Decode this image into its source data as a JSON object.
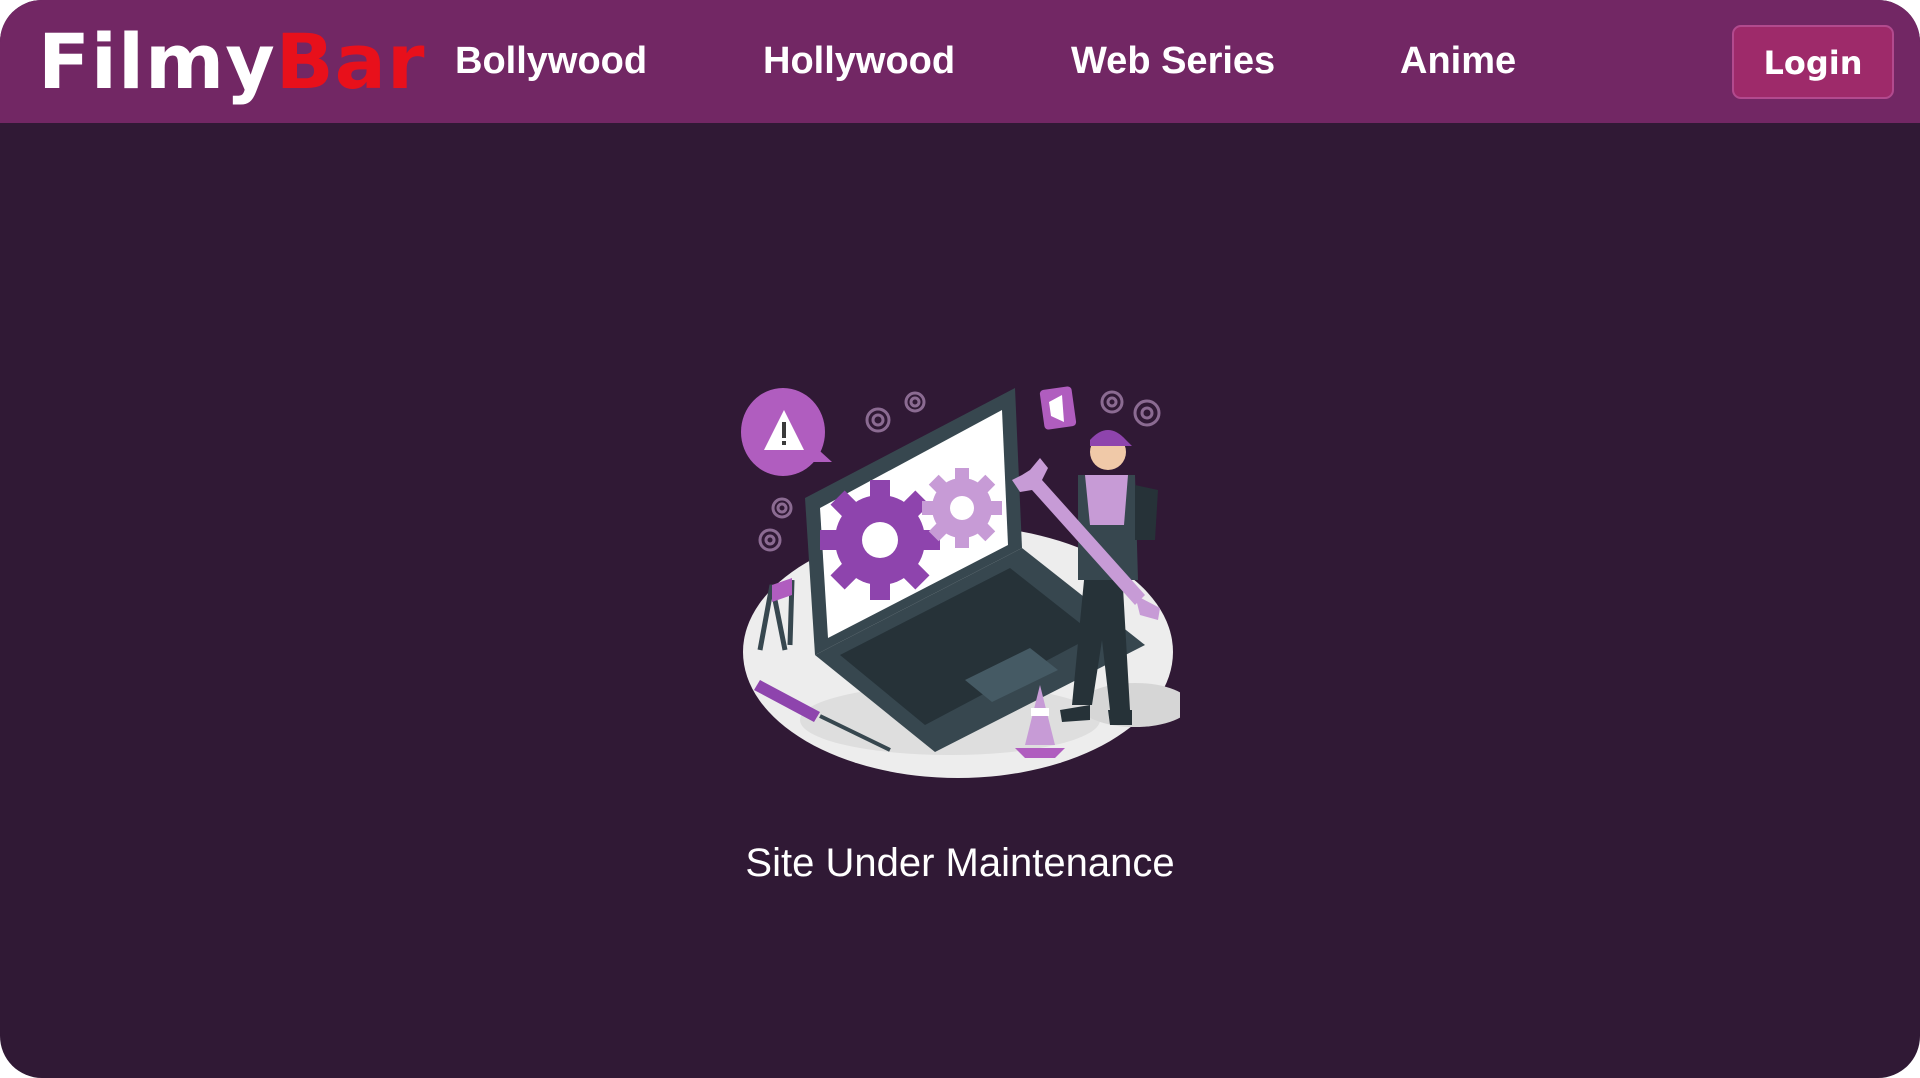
{
  "brand": {
    "logo_part1": "Filmy",
    "logo_part2": "Bar",
    "colors": {
      "navbar": "#722764",
      "background": "#301935",
      "logo_accent": "#e8101b",
      "login_button": "#9e2a6a"
    }
  },
  "nav": {
    "links": [
      {
        "label": "Bollywood"
      },
      {
        "label": "Hollywood"
      },
      {
        "label": "Web Series"
      },
      {
        "label": "Anime"
      }
    ],
    "login_label": "Login"
  },
  "main": {
    "illustration": "maintenance-illustration",
    "status_text": "Site Under Maintenance"
  }
}
